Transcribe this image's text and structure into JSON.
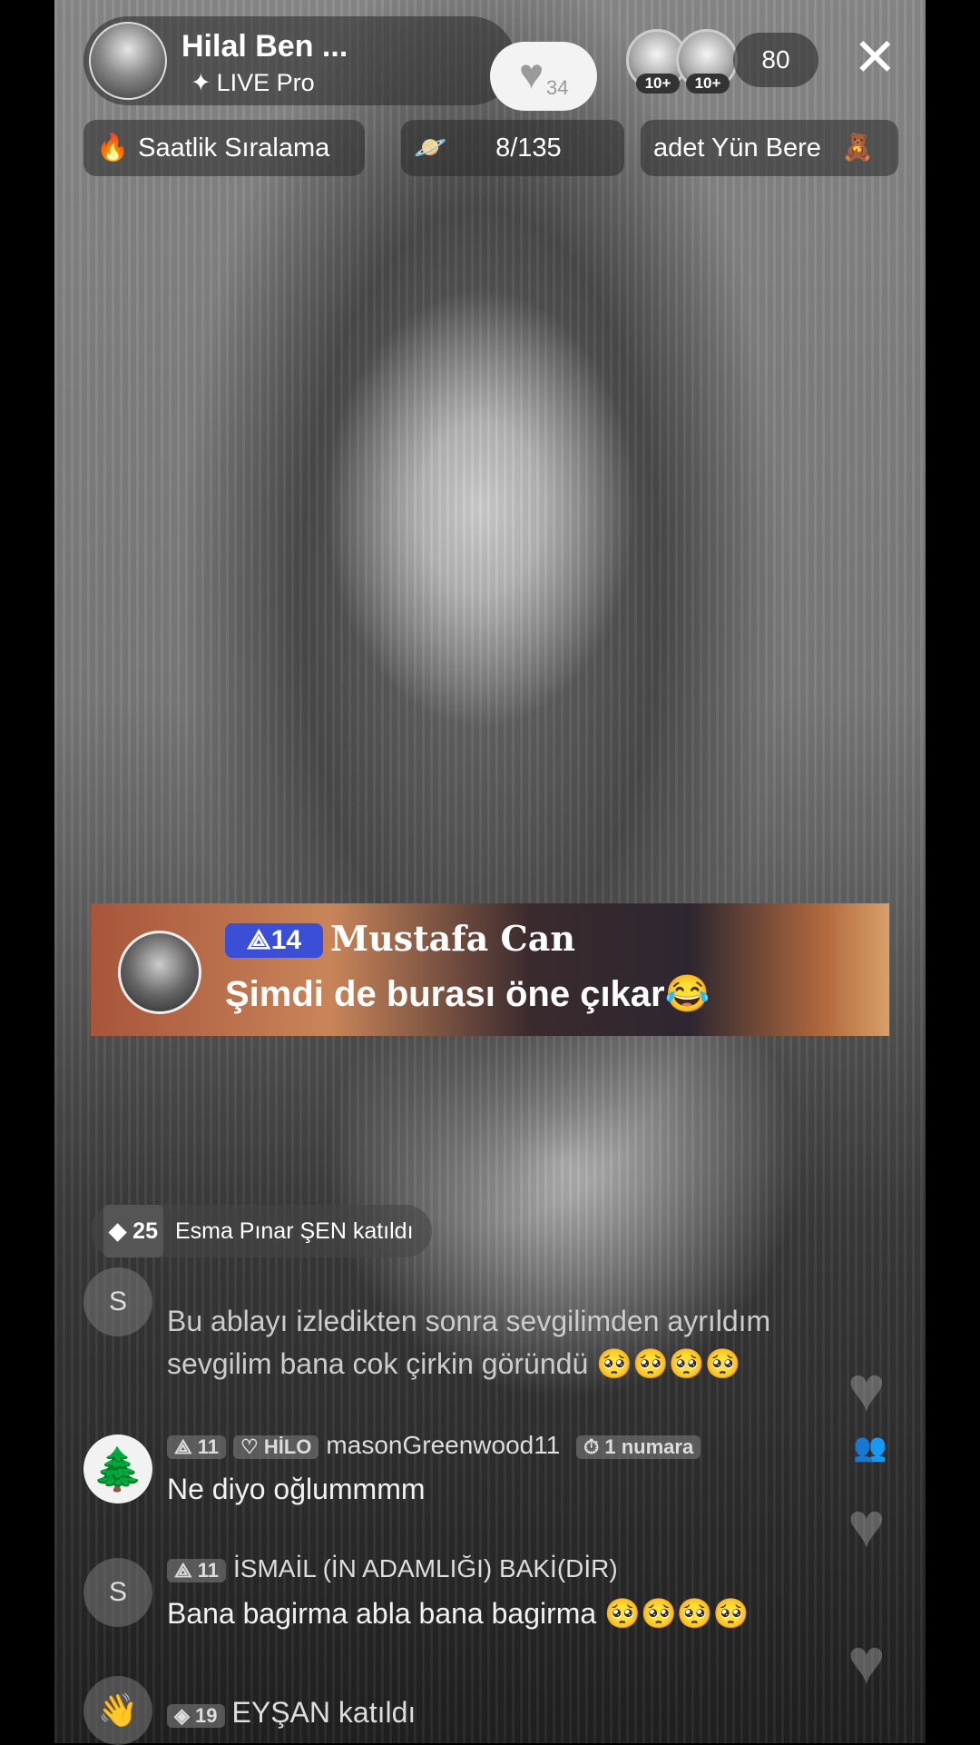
{
  "host": {
    "name": "Hilal Ben ...",
    "subtitle": "LIVE Pro",
    "subtitle_icon": "sparkle-icon",
    "like_count": "34"
  },
  "top_right": {
    "viewer_avatars": [
      {
        "tag": "10+"
      },
      {
        "tag": "10+"
      }
    ],
    "viewer_count": "80",
    "close_icon": "close-icon"
  },
  "chips": {
    "ranking_label": "Saatlik Sıralama",
    "goal_progress": "8/135",
    "gift_label": "adet Yün Bere"
  },
  "featured_comment": {
    "level": "14",
    "username": "Mustafa Can",
    "text": "Şimdi de burası öne çıkar😂"
  },
  "join_event": {
    "level": "25",
    "text": "Esma Pınar ŞEN katıldı"
  },
  "messages": [
    {
      "avatar": "S",
      "line1": "Bu ablayı izledikten sonra sevgilimden ayrıldım",
      "line2": "sevgilim bana cok çirkin göründü 🥺🥺🥺🥺"
    },
    {
      "avatar": "🌲",
      "level": "11",
      "fan_badge": "HİLO",
      "username": "masonGreenwood11",
      "rank_badge": "1 numara",
      "text": "Ne diyo oğlummmm"
    },
    {
      "avatar": "S",
      "level": "11",
      "username": "İSMAİL (İN ADAMLIĞI) BAKİ(DİR)",
      "text": "Bana bagirma abla bana bagirma 🥺🥺🥺🥺"
    }
  ],
  "join_event_2": {
    "level": "19",
    "text": "EYŞAN katıldı"
  }
}
